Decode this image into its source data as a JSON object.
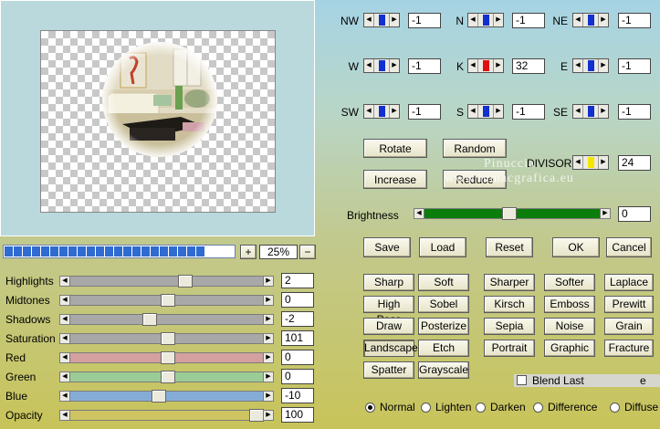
{
  "zoom": {
    "value": "25%",
    "plus": "+",
    "minus": "−"
  },
  "progress": {
    "segments": 22
  },
  "adjustments": [
    {
      "label": "Highlights",
      "value": "2",
      "thumb": 0.6,
      "track": "#a8a8a8"
    },
    {
      "label": "Midtones",
      "value": "0",
      "thumb": 0.5,
      "track": "#a8a8a8"
    },
    {
      "label": "Shadows",
      "value": "-2",
      "thumb": 0.4,
      "track": "#a8a8a8"
    },
    {
      "label": "Saturation",
      "value": "101",
      "thumb": 0.5,
      "track": "#a8a8a8"
    },
    {
      "label": "Red",
      "value": "0",
      "thumb": 0.5,
      "track": "#d4a0a0"
    },
    {
      "label": "Green",
      "value": "0",
      "thumb": 0.5,
      "track": "#9bcc96"
    },
    {
      "label": "Blue",
      "value": "-10",
      "thumb": 0.45,
      "track": "#85acd6"
    },
    {
      "label": "Opacity",
      "value": "100",
      "thumb": 1.0,
      "track": "#cfc462"
    }
  ],
  "kernel": [
    {
      "label": "NW",
      "value": "-1",
      "mark": "#1030d0"
    },
    {
      "label": "N",
      "value": "-1",
      "mark": "#1030d0"
    },
    {
      "label": "NE",
      "value": "-1",
      "mark": "#1030d0"
    },
    {
      "label": "W",
      "value": "-1",
      "mark": "#1030d0"
    },
    {
      "label": "K",
      "value": "32",
      "mark": "#e01010"
    },
    {
      "label": "E",
      "value": "-1",
      "mark": "#1030d0"
    },
    {
      "label": "SW",
      "value": "-1",
      "mark": "#1030d0"
    },
    {
      "label": "S",
      "value": "-1",
      "mark": "#1030d0"
    },
    {
      "label": "SE",
      "value": "-1",
      "mark": "#1030d0"
    }
  ],
  "kernel_buttons": {
    "rotate": "Rotate",
    "random": "Random",
    "increase": "Increase",
    "reduce": "Reduce"
  },
  "divisor": {
    "label": "DIVISOR",
    "value": "24",
    "mark": "#f5e600"
  },
  "brightness": {
    "label": "Brightness",
    "value": "0",
    "thumb": 0.48,
    "track": "#0a7d0a"
  },
  "actions": {
    "save": "Save",
    "load": "Load",
    "reset": "Reset",
    "ok": "OK",
    "cancel": "Cancel"
  },
  "presets": [
    [
      "Sharp",
      "Soft",
      "Sharper",
      "Softer",
      "Laplace"
    ],
    [
      "High Pass",
      "Sobel",
      "Kirsch",
      "Emboss",
      "Prewitt"
    ],
    [
      "Draw",
      "Posterize",
      "Sepia",
      "Noise",
      "Grain"
    ],
    [
      "Landscape",
      "Etch",
      "Portrait",
      "Graphic",
      "Fracture"
    ],
    [
      "Spatter",
      "Grayscale"
    ]
  ],
  "blend_last": {
    "label": "Blend Last",
    "suffix": "e",
    "checked": false
  },
  "blend_modes": [
    {
      "label": "Normal",
      "selected": true
    },
    {
      "label": "Lighten",
      "selected": false
    },
    {
      "label": "Darken",
      "selected": false
    },
    {
      "label": "Difference",
      "selected": false
    },
    {
      "label": "Diffuse",
      "selected": false
    }
  ],
  "watermark": {
    "line1": "Pinuccia",
    "line2": "www.inmacgrafica.eu"
  }
}
